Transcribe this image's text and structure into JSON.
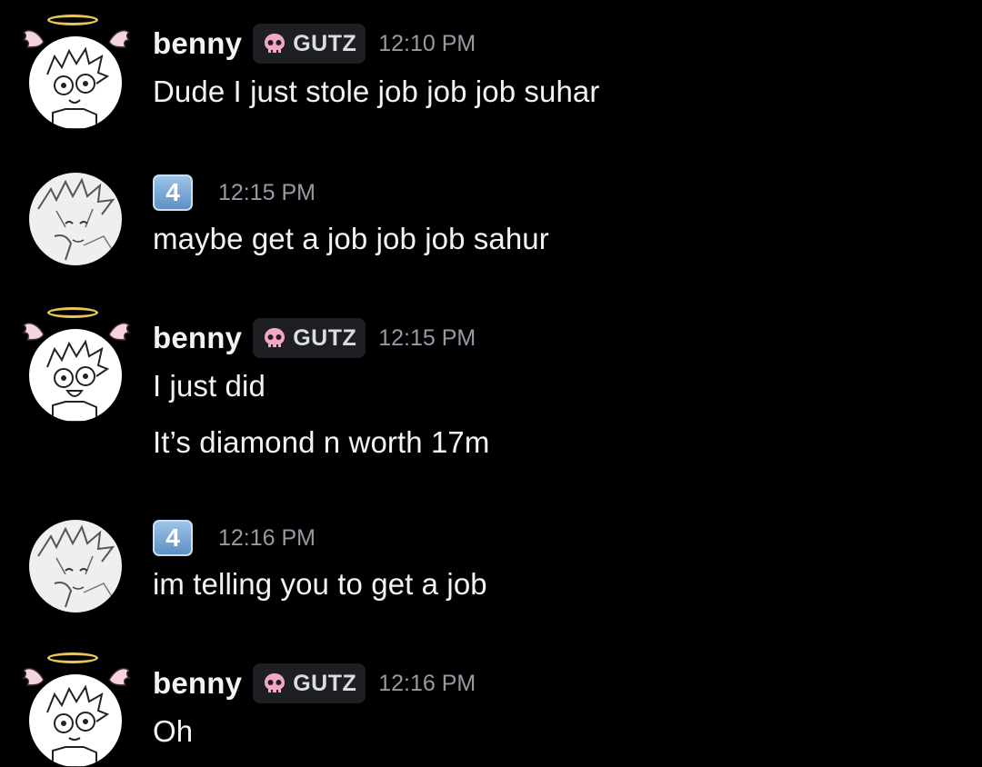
{
  "messages": [
    {
      "author": "benny",
      "role_tag": "GUTZ",
      "time": "12:10 PM",
      "lines": [
        "Dude I just stole job job job suhar"
      ]
    },
    {
      "author_badge": "4",
      "time": "12:15 PM",
      "lines": [
        "maybe get a job job job sahur"
      ]
    },
    {
      "author": "benny",
      "role_tag": "GUTZ",
      "time": "12:15 PM",
      "lines": [
        "I just did",
        "It’s diamond n worth 17m"
      ]
    },
    {
      "author_badge": "4",
      "time": "12:16 PM",
      "lines": [
        "im telling you to get a job"
      ]
    },
    {
      "author": "benny",
      "role_tag": "GUTZ",
      "time": "12:16 PM",
      "lines": [
        "Oh"
      ]
    }
  ],
  "icons": {
    "role_icon": "skull-icon",
    "avatar_decoration": "halo-wings-icon"
  },
  "colors": {
    "background": "#000000",
    "text": "#f2f3f5",
    "timestamp": "#949ba4",
    "role_tag_bg": "#1e1f22",
    "skull": "#f4a6c6"
  }
}
